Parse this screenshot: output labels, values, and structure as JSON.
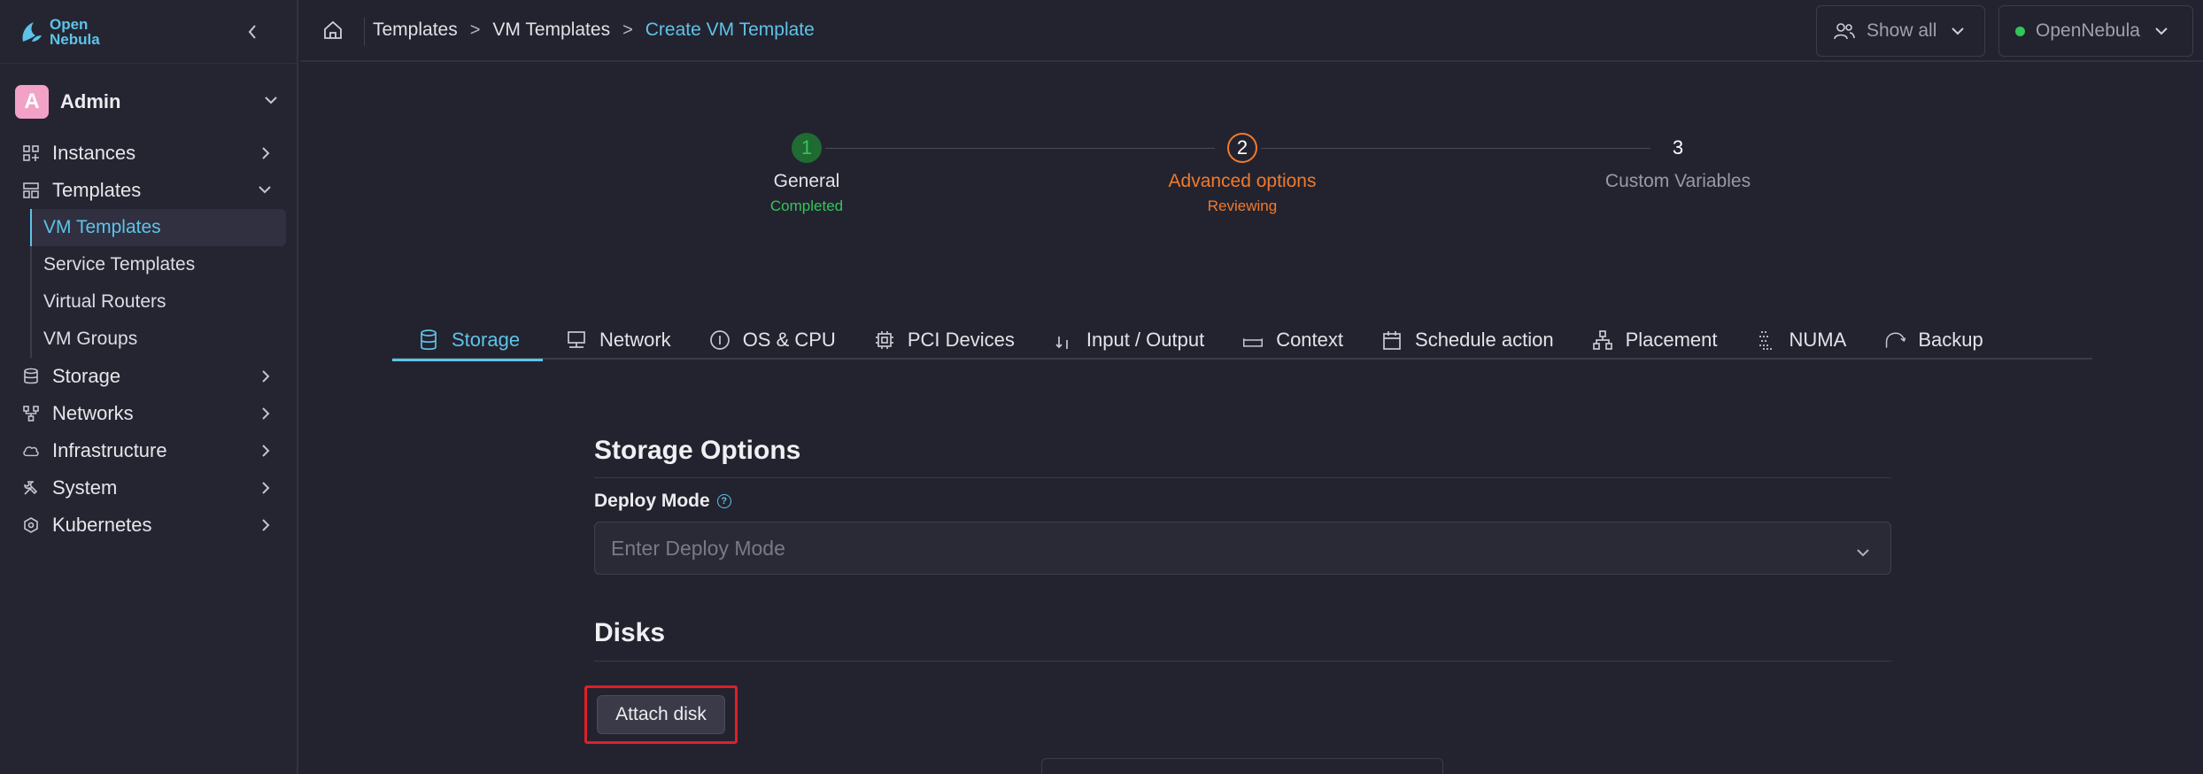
{
  "sidebar": {
    "logo_line1": "Open",
    "logo_line2": "Nebula",
    "user": {
      "initial": "A",
      "name": "Admin"
    },
    "nav": [
      {
        "label": "Instances",
        "icon": "grid-icon"
      },
      {
        "label": "Templates",
        "icon": "templates-icon",
        "expanded": true
      },
      {
        "label": "Storage",
        "icon": "database-icon"
      },
      {
        "label": "Networks",
        "icon": "network-icon"
      },
      {
        "label": "Infrastructure",
        "icon": "cloud-icon"
      },
      {
        "label": "System",
        "icon": "tools-icon"
      },
      {
        "label": "Kubernetes",
        "icon": "kubernetes-icon"
      }
    ],
    "templates_sub": [
      "VM Templates",
      "Service Templates",
      "Virtual Routers",
      "VM Groups"
    ]
  },
  "topbar": {
    "breadcrumb": [
      "Templates",
      "VM Templates",
      "Create VM Template"
    ],
    "filter_label": "Show all",
    "zone_label": "OpenNebula",
    "zone_status_color": "#32c55a"
  },
  "stepper": [
    {
      "number": "1",
      "title": "General",
      "status": "Completed",
      "state": "completed"
    },
    {
      "number": "2",
      "title": "Advanced options",
      "status": "Reviewing",
      "state": "active"
    },
    {
      "number": "3",
      "title": "Custom Variables",
      "status": "",
      "state": "pending"
    }
  ],
  "tabs": [
    {
      "label": "Storage",
      "icon": "database-icon",
      "active": true
    },
    {
      "label": "Network",
      "icon": "monitor-network-icon"
    },
    {
      "label": "OS & CPU",
      "icon": "info-circle-icon"
    },
    {
      "label": "PCI Devices",
      "icon": "chip-icon"
    },
    {
      "label": "Input / Output",
      "icon": "input-output-icon"
    },
    {
      "label": "Context",
      "icon": "context-icon"
    },
    {
      "label": "Schedule action",
      "icon": "calendar-icon"
    },
    {
      "label": "Placement",
      "icon": "hierarchy-icon"
    },
    {
      "label": "NUMA",
      "icon": "numa-icon"
    },
    {
      "label": "Backup",
      "icon": "backup-icon"
    }
  ],
  "storage": {
    "section_title": "Storage Options",
    "deploy_mode_label": "Deploy Mode",
    "deploy_mode_placeholder": "Enter Deploy Mode",
    "disks_title": "Disks",
    "attach_disk_label": "Attach disk"
  },
  "colors": {
    "accent": "#5ec3e8",
    "completed": "#32c55a",
    "active": "#f07a2c",
    "highlight": "#e01e2b"
  }
}
